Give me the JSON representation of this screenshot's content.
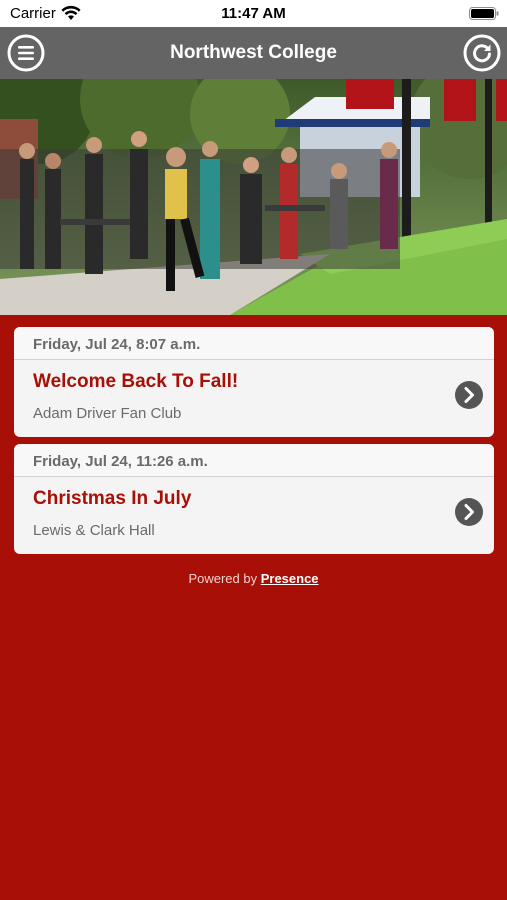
{
  "status_bar": {
    "carrier": "Carrier",
    "time": "11:47 AM",
    "icons": [
      "wifi-icon",
      "battery-icon"
    ]
  },
  "nav": {
    "title": "Northwest College",
    "left_icon": "menu-icon",
    "right_icon": "refresh-icon",
    "bar_color": "#646464"
  },
  "hero": {
    "description_icon": "campus-photo"
  },
  "events": [
    {
      "date": "Friday, Jul 24, 8:07 a.m.",
      "title": "Welcome Back To Fall!",
      "subtitle": "Adam Driver Fan Club"
    },
    {
      "date": "Friday, Jul 24, 11:26 a.m.",
      "title": "Christmas In July",
      "subtitle": "Lewis & Clark Hall"
    }
  ],
  "footer": {
    "prefix": "Powered by",
    "link": "Presence"
  },
  "colors": {
    "brand_red": "#a80f06",
    "card_bg": "#f4f4f4",
    "chevron_bg": "#555555"
  }
}
